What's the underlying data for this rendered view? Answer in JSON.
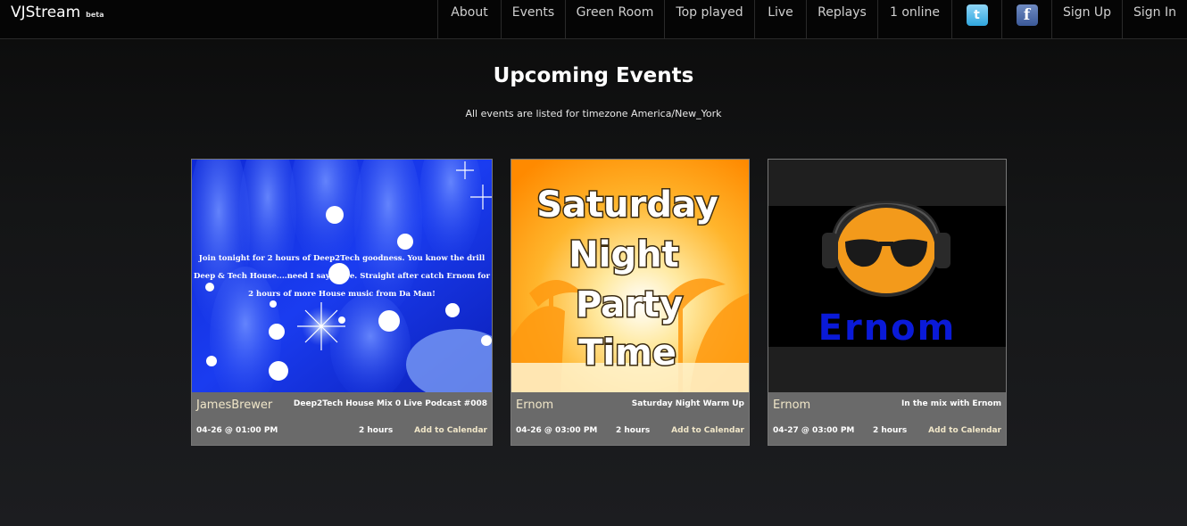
{
  "brand": {
    "name": "VJStream",
    "badge": "beta"
  },
  "nav": {
    "items": [
      "About",
      "Events",
      "Green Room",
      "Top played",
      "Live",
      "Replays",
      "1 online"
    ],
    "twitter_icon": "twitter-icon",
    "facebook_icon": "facebook-icon",
    "sign_up": "Sign Up",
    "sign_in": "Sign In"
  },
  "page": {
    "title": "Upcoming Events",
    "subtitle": "All events are listed for timezone America/New_York"
  },
  "events": [
    {
      "artist": "JamesBrewer",
      "title": "Deep2Tech House Mix 0 Live Podcast #008",
      "datetime": "04-26 @ 01:00 PM",
      "duration": "2 hours",
      "calendar": "Add to Calendar",
      "image_text": "Join tonight for 2 hours of Deep2Tech goodness. You know the drill Deep & Tech House....need I say more. Straight after catch Ernom for 2 hours of more House music from Da Man!"
    },
    {
      "artist": "Ernom",
      "title": "Saturday Night Warm Up",
      "datetime": "04-26 @ 03:00 PM",
      "duration": "2 hours",
      "calendar": "Add to Calendar",
      "image_lines": [
        "Saturday",
        "Night",
        "Party",
        "Time"
      ]
    },
    {
      "artist": "Ernom",
      "title": "In the mix with Ernom",
      "datetime": "04-27 @ 03:00 PM",
      "duration": "2 hours",
      "calendar": "Add to Calendar",
      "image_logo": "Ernom"
    }
  ],
  "colors": {
    "nav_bg": "#050505",
    "card_info_bg": "#6a6a6a",
    "link": "#f0e6c8",
    "blue_art": "#1530d8"
  }
}
